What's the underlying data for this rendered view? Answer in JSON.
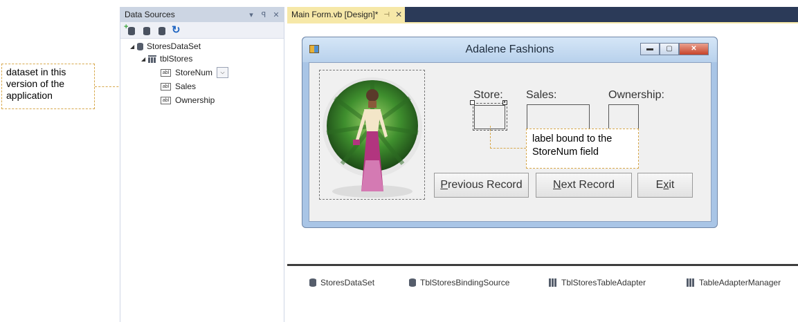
{
  "data_sources": {
    "title": "Data Sources",
    "header_buttons": [
      "▾",
      "ꟼ",
      "✕"
    ],
    "tree": {
      "dataset": "StoresDataSet",
      "table": "tblStores",
      "fields": [
        "StoreNum",
        "Sales",
        "Ownership"
      ],
      "storenum_dropdown": "⌵"
    }
  },
  "designer": {
    "tab_label": "Main Form.vb [Design]*",
    "tab_pin": "⊣",
    "tab_close": "✕",
    "tray_items": [
      "StoresDataSet",
      "TblStoresBindingSource",
      "TblStoresTableAdapter",
      "TableAdapterManager"
    ]
  },
  "form": {
    "title": "Adalene Fashions",
    "labels": {
      "store": "Store:",
      "sales": "Sales:",
      "ownership": "Ownership:"
    },
    "buttons": {
      "previous": {
        "mnemonic": "P",
        "rest": "revious Record"
      },
      "next": {
        "mnemonic": "N",
        "rest": "ext Record"
      },
      "exit": {
        "pre": "E",
        "mnemonic": "x",
        "post": "it"
      }
    }
  },
  "callouts": {
    "dataset": "dataset in this version of the application",
    "label": "label bound to the StoreNum field"
  },
  "colors": {
    "callout_border": "#d7a74a",
    "tab_active": "#f6e8a8",
    "tabstrip": "#2b3a58",
    "form_border": "#a9c5e6"
  }
}
